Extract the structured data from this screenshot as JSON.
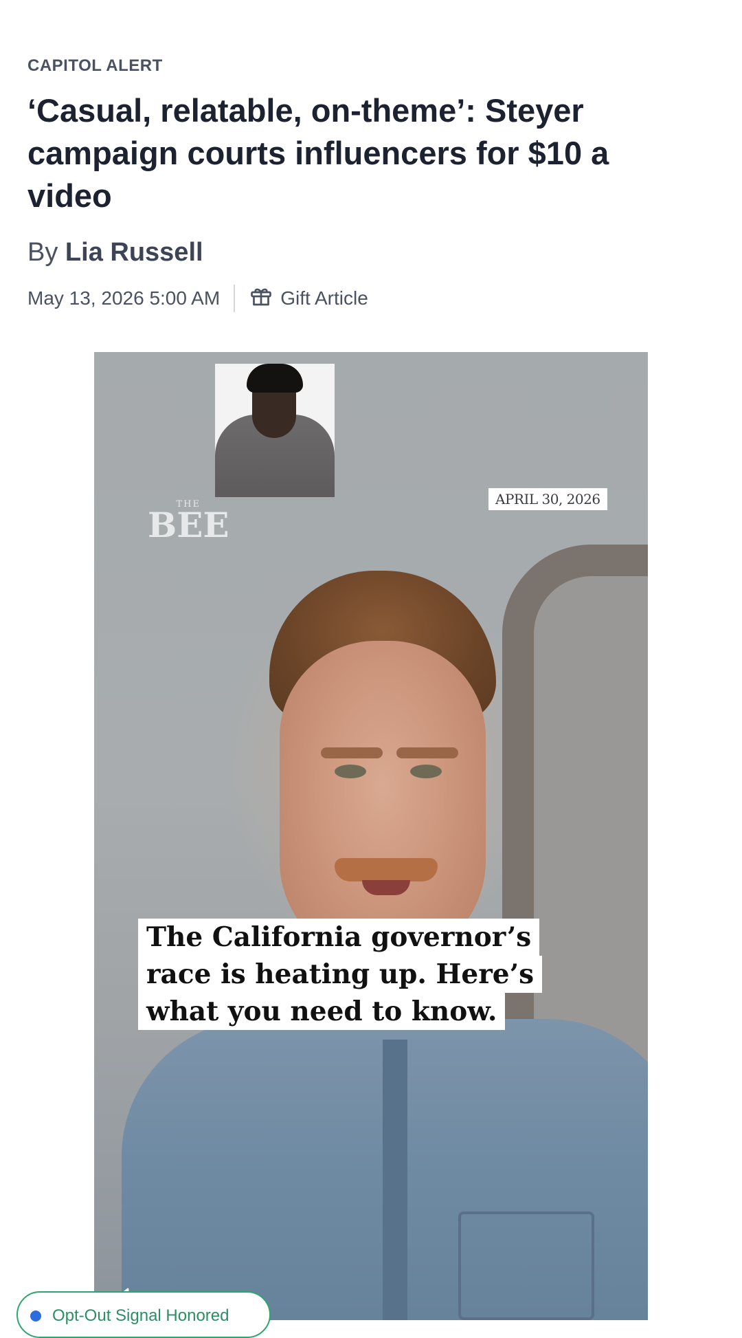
{
  "article": {
    "kicker": "CAPITOL ALERT",
    "headline": "‘Casual, relatable, on-theme’: Steyer campaign courts influencers for $10 a video",
    "byline_prefix": "By",
    "author": "Lia Russell",
    "timestamp": "May 13, 2026 5:00 AM",
    "gift_label": "Gift Article"
  },
  "video": {
    "logo_small": "THE",
    "logo_main": "BEE",
    "date_tag": "APRIL 30, 2026",
    "caption": "The California governor’s race is heating up. Here’s what you need to know.",
    "muted": true
  },
  "privacy_badge": {
    "label": "Opt-Out Signal Honored",
    "dot_color": "#2d6cdf",
    "border_color": "#2ea56e"
  },
  "icons": {
    "gift": "gift-icon",
    "mute": "mute-icon"
  }
}
